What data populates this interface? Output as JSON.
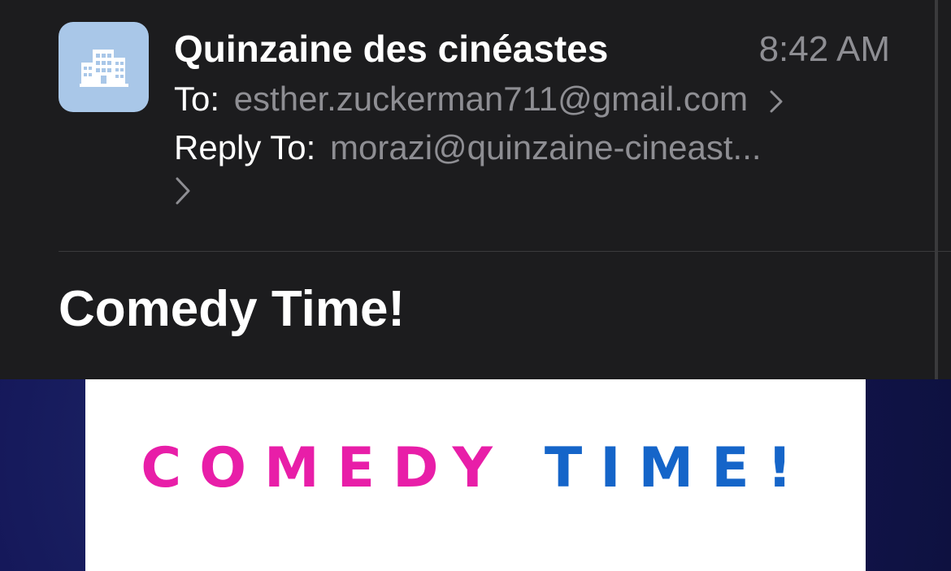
{
  "email": {
    "sender": "Quinzaine des cinéastes",
    "time": "8:42 AM",
    "to_label": "To:",
    "to_value": "esther.zuckerman711@gmail.com",
    "reply_to_label": "Reply To:",
    "reply_to_value": "morazi@quinzaine-cineast...",
    "subject": "Comedy Time!"
  },
  "content": {
    "banner_part1": "COMEDY",
    "banner_part2": "TIME!"
  },
  "icons": {
    "avatar": "building-icon",
    "disclosure": "chevron-right-icon"
  },
  "colors": {
    "background": "#1c1c1e",
    "avatar_bg": "#a9c7e8",
    "secondary_text": "#8e8e93",
    "pink": "#e81ea8",
    "blue": "#1565c9"
  }
}
